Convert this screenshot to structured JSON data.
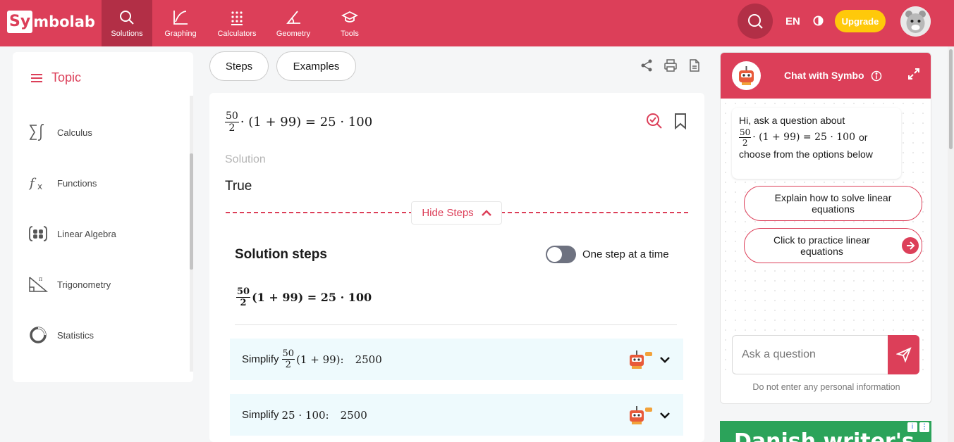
{
  "colors": {
    "brand": "#dc3f59",
    "brand_dark": "#b22f46",
    "upgrade": "#ffc90a",
    "step_bg": "#eefafd"
  },
  "header": {
    "logo_prefix": "Sy",
    "logo_rest": "mbolab",
    "nav": [
      {
        "label": "Solutions",
        "icon": "search-icon"
      },
      {
        "label": "Graphing",
        "icon": "graph-icon"
      },
      {
        "label": "Calculators",
        "icon": "calculator-icon"
      },
      {
        "label": "Geometry",
        "icon": "angle-icon"
      },
      {
        "label": "Tools",
        "icon": "graduation-cap-icon"
      }
    ],
    "language": "EN",
    "upgrade_label": "Upgrade"
  },
  "sidebar": {
    "title": "Topic",
    "items": [
      {
        "label": "Calculus",
        "icon": "sigma-integral-icon"
      },
      {
        "label": "Functions",
        "icon": "fx-icon"
      },
      {
        "label": "Linear Algebra",
        "icon": "matrix-icon"
      },
      {
        "label": "Trigonometry",
        "icon": "triangle-pi-icon"
      },
      {
        "label": "Statistics",
        "icon": "pie-chart-icon"
      }
    ]
  },
  "tabs": {
    "steps_label": "Steps",
    "examples_label": "Examples"
  },
  "problem": {
    "frac_num": "50",
    "frac_den": "2",
    "rest": "· (1 + 99) = 25 · 100"
  },
  "solution": {
    "label": "Solution",
    "value": "True",
    "hide_steps_label": "Hide Steps",
    "steps_title": "Solution steps",
    "toggle_label": "One step at a time",
    "step_eq_num": "50",
    "step_eq_den": "2",
    "step_eq_rest": "(1 + 99) = 25 · 100",
    "steps": [
      {
        "prefix": "Simplify",
        "num": "50",
        "den": "2",
        "expr": "(1 + 99):",
        "result": "2500"
      },
      {
        "prefix": "Simplify",
        "expr": "25 · 100:",
        "result": "2500"
      }
    ]
  },
  "chat": {
    "title": "Chat with Symbo",
    "intro_before": "Hi, ask a question about",
    "intro_num": "50",
    "intro_den": "2",
    "intro_expr": "· (1 + 99) = 25 · 100",
    "intro_after": "or",
    "intro_tail": "choose from the options below",
    "options": [
      "Explain how to solve linear equations",
      "Click to practice linear equations"
    ],
    "input_placeholder": "Ask a question",
    "disclaimer": "Do not enter any personal information"
  },
  "ad": {
    "text": "Danish writer's"
  }
}
